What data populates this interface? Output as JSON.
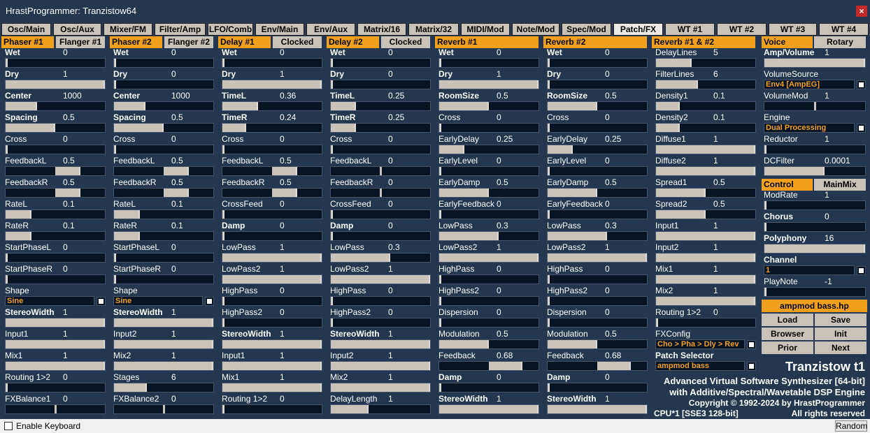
{
  "window": {
    "title": "HrastProgrammer: Tranzistow64",
    "close_glyph": "×"
  },
  "tabs": [
    "Osc/Main",
    "Osc/Aux",
    "Mixer/FM",
    "Filter/Amp",
    "LFO/Comb",
    "Env/Main",
    "Env/Aux",
    "Matrix/16",
    "Matrix/32",
    "MIDI/Mod",
    "Note/Mod",
    "Spec/Mod",
    "Patch/FX",
    "WT #1",
    "WT #2",
    "WT #3",
    "WT #4"
  ],
  "active_tab": "Patch/FX",
  "sections": [
    {
      "header": "Phaser #1",
      "header2": "Flanger #1",
      "params": [
        {
          "label": "Wet",
          "value": "0",
          "bold": true,
          "level": 0
        },
        {
          "label": "Dry",
          "value": "1",
          "bold": true,
          "level": 1
        },
        {
          "label": "Center",
          "value": "1000",
          "bold": true,
          "level": 0.32
        },
        {
          "label": "Spacing",
          "value": "0.5",
          "bold": true,
          "level": 0.5
        },
        {
          "label": "Cross",
          "value": "0",
          "bold": false,
          "level": 0
        },
        {
          "label": "FeedbackL",
          "value": "0.5",
          "bold": false,
          "level": 0.75,
          "bipolar": true
        },
        {
          "label": "FeedbackR",
          "value": "0.5",
          "bold": false,
          "level": 0.75,
          "bipolar": true
        },
        {
          "label": "RateL",
          "value": "0.1",
          "bold": false,
          "level": 0.26
        },
        {
          "label": "RateR",
          "value": "0.1",
          "bold": false,
          "level": 0.26
        },
        {
          "label": "StartPhaseL",
          "value": "0",
          "bold": false,
          "level": 0
        },
        {
          "label": "StartPhaseR",
          "value": "0",
          "bold": false,
          "level": 0
        },
        {
          "label": "Shape",
          "value": "",
          "bold": false,
          "select": "Sine"
        },
        {
          "label": "StereoWidth",
          "value": "1",
          "bold": true,
          "level": 1
        },
        {
          "label": "Input1",
          "value": "1",
          "bold": false,
          "level": 1
        },
        {
          "label": "Mix1",
          "value": "1",
          "bold": false,
          "level": 1
        },
        {
          "label": "Routing 1>2",
          "value": "0",
          "bold": false,
          "level": 0
        },
        {
          "label": "FXBalance1",
          "value": "0",
          "bold": false,
          "level": 0.5,
          "knob": true
        }
      ]
    },
    {
      "header": "Phaser #2",
      "header2": "Flanger #2",
      "params": [
        {
          "label": "Wet",
          "value": "0",
          "bold": true,
          "level": 0
        },
        {
          "label": "Dry",
          "value": "0",
          "bold": true,
          "level": 0
        },
        {
          "label": "Center",
          "value": "1000",
          "bold": true,
          "level": 0.32
        },
        {
          "label": "Spacing",
          "value": "0.5",
          "bold": true,
          "level": 0.5
        },
        {
          "label": "Cross",
          "value": "0",
          "bold": false,
          "level": 0
        },
        {
          "label": "FeedbackL",
          "value": "0.5",
          "bold": false,
          "level": 0.75,
          "bipolar": true
        },
        {
          "label": "FeedbackR",
          "value": "0.5",
          "bold": false,
          "level": 0.75,
          "bipolar": true
        },
        {
          "label": "RateL",
          "value": "0.1",
          "bold": false,
          "level": 0.26
        },
        {
          "label": "RateR",
          "value": "0.1",
          "bold": false,
          "level": 0.26
        },
        {
          "label": "StartPhaseL",
          "value": "0",
          "bold": false,
          "level": 0
        },
        {
          "label": "StartPhaseR",
          "value": "0",
          "bold": false,
          "level": 0
        },
        {
          "label": "Shape",
          "value": "",
          "bold": false,
          "select": "Sine"
        },
        {
          "label": "StereoWidth",
          "value": "1",
          "bold": true,
          "level": 1
        },
        {
          "label": "Input2",
          "value": "1",
          "bold": false,
          "level": 1
        },
        {
          "label": "Mix2",
          "value": "1",
          "bold": false,
          "level": 1
        },
        {
          "label": "Stages",
          "value": "6",
          "bold": false,
          "level": 0.33
        },
        {
          "label": "FXBalance2",
          "value": "0",
          "bold": false,
          "level": 0.5,
          "knob": true
        }
      ]
    },
    {
      "header": "Delay #1",
      "header2": "Clocked",
      "params": [
        {
          "label": "Wet",
          "value": "0",
          "bold": true,
          "level": 0
        },
        {
          "label": "Dry",
          "value": "1",
          "bold": true,
          "level": 1
        },
        {
          "label": "TimeL",
          "value": "0.36",
          "bold": true,
          "level": 0.36
        },
        {
          "label": "TimeR",
          "value": "0.24",
          "bold": true,
          "level": 0.24
        },
        {
          "label": "Cross",
          "value": "0",
          "bold": false,
          "level": 0
        },
        {
          "label": "FeedbackL",
          "value": "0.5",
          "bold": false,
          "level": 0.75,
          "bipolar": true
        },
        {
          "label": "FeedbackR",
          "value": "0.5",
          "bold": false,
          "level": 0.75,
          "bipolar": true
        },
        {
          "label": "CrossFeed",
          "value": "0",
          "bold": false,
          "level": 0
        },
        {
          "label": "Damp",
          "value": "0",
          "bold": true,
          "level": 0
        },
        {
          "label": "LowPass",
          "value": "1",
          "bold": false,
          "level": 1
        },
        {
          "label": "LowPass2",
          "value": "1",
          "bold": false,
          "level": 1
        },
        {
          "label": "HighPass",
          "value": "0",
          "bold": false,
          "level": 0
        },
        {
          "label": "HighPass2",
          "value": "0",
          "bold": false,
          "level": 0
        },
        {
          "label": "StereoWidth",
          "value": "1",
          "bold": true,
          "level": 1
        },
        {
          "label": "Input1",
          "value": "1",
          "bold": false,
          "level": 1
        },
        {
          "label": "Mix1",
          "value": "1",
          "bold": false,
          "level": 1
        },
        {
          "label": "Routing 1>2",
          "value": "0",
          "bold": false,
          "level": 0
        }
      ]
    },
    {
      "header": "Delay #2",
      "header2": "Clocked",
      "params": [
        {
          "label": "Wet",
          "value": "0",
          "bold": true,
          "level": 0
        },
        {
          "label": "Dry",
          "value": "0",
          "bold": true,
          "level": 0
        },
        {
          "label": "TimeL",
          "value": "0.25",
          "bold": true,
          "level": 0.25
        },
        {
          "label": "TimeR",
          "value": "0.25",
          "bold": true,
          "level": 0.25
        },
        {
          "label": "Cross",
          "value": "0",
          "bold": false,
          "level": 0
        },
        {
          "label": "FeedbackL",
          "value": "0",
          "bold": false,
          "level": 0.5,
          "knob": true
        },
        {
          "label": "FeedbackR",
          "value": "0",
          "bold": false,
          "level": 0.5,
          "knob": true
        },
        {
          "label": "CrossFeed",
          "value": "0",
          "bold": false,
          "level": 0
        },
        {
          "label": "Damp",
          "value": "0",
          "bold": true,
          "level": 0
        },
        {
          "label": "LowPass",
          "value": "0.3",
          "bold": false,
          "level": 0.6
        },
        {
          "label": "LowPass2",
          "value": "1",
          "bold": false,
          "level": 1
        },
        {
          "label": "HighPass",
          "value": "0",
          "bold": false,
          "level": 0
        },
        {
          "label": "HighPass2",
          "value": "0",
          "bold": false,
          "level": 0
        },
        {
          "label": "StereoWidth",
          "value": "1",
          "bold": true,
          "level": 1
        },
        {
          "label": "Input2",
          "value": "1",
          "bold": false,
          "level": 1
        },
        {
          "label": "Mix2",
          "value": "1",
          "bold": false,
          "level": 1
        },
        {
          "label": "DelayLength",
          "value": "1",
          "bold": false,
          "level": 0.38
        }
      ]
    },
    {
      "header": "Reverb #1",
      "header2": "",
      "params": [
        {
          "label": "Wet",
          "value": "0",
          "bold": true,
          "level": 0
        },
        {
          "label": "Dry",
          "value": "1",
          "bold": true,
          "level": 1
        },
        {
          "label": "RoomSize",
          "value": "0.5",
          "bold": true,
          "level": 0.5
        },
        {
          "label": "Cross",
          "value": "0",
          "bold": false,
          "level": 0
        },
        {
          "label": "EarlyDelay",
          "value": "0.25",
          "bold": false,
          "level": 0.25
        },
        {
          "label": "EarlyLevel",
          "value": "0",
          "bold": false,
          "level": 0
        },
        {
          "label": "EarlyDamp",
          "value": "0.5",
          "bold": false,
          "level": 0.5
        },
        {
          "label": "EarlyFeedback",
          "value": "0",
          "bold": false,
          "level": 0
        },
        {
          "label": "LowPass",
          "value": "0.3",
          "bold": false,
          "level": 0.6
        },
        {
          "label": "LowPass2",
          "value": "1",
          "bold": false,
          "level": 1
        },
        {
          "label": "HighPass",
          "value": "0",
          "bold": false,
          "level": 0
        },
        {
          "label": "HighPass2",
          "value": "0",
          "bold": false,
          "level": 0
        },
        {
          "label": "Dispersion",
          "value": "0",
          "bold": false,
          "level": 0
        },
        {
          "label": "Modulation",
          "value": "0.5",
          "bold": false,
          "level": 0.5
        },
        {
          "label": "Feedback",
          "value": "0.68",
          "bold": false,
          "level": 0.84,
          "bipolar": true
        },
        {
          "label": "Damp",
          "value": "0",
          "bold": true,
          "level": 0
        },
        {
          "label": "StereoWidth",
          "value": "1",
          "bold": true,
          "level": 1
        }
      ]
    },
    {
      "header": "Reverb #2",
      "header2": "",
      "params": [
        {
          "label": "Wet",
          "value": "0",
          "bold": true,
          "level": 0
        },
        {
          "label": "Dry",
          "value": "0",
          "bold": true,
          "level": 0
        },
        {
          "label": "RoomSize",
          "value": "0.5",
          "bold": true,
          "level": 0.5
        },
        {
          "label": "Cross",
          "value": "0",
          "bold": false,
          "level": 0
        },
        {
          "label": "EarlyDelay",
          "value": "0.25",
          "bold": false,
          "level": 0.25
        },
        {
          "label": "EarlyLevel",
          "value": "0",
          "bold": false,
          "level": 0
        },
        {
          "label": "EarlyDamp",
          "value": "0.5",
          "bold": false,
          "level": 0.5
        },
        {
          "label": "EarlyFeedback",
          "value": "0",
          "bold": false,
          "level": 0
        },
        {
          "label": "LowPass",
          "value": "0.3",
          "bold": false,
          "level": 0.6
        },
        {
          "label": "LowPass2",
          "value": "1",
          "bold": false,
          "level": 1
        },
        {
          "label": "HighPass",
          "value": "0",
          "bold": false,
          "level": 0
        },
        {
          "label": "HighPass2",
          "value": "0",
          "bold": false,
          "level": 0
        },
        {
          "label": "Dispersion",
          "value": "0",
          "bold": false,
          "level": 0
        },
        {
          "label": "Modulation",
          "value": "0.5",
          "bold": false,
          "level": 0.5
        },
        {
          "label": "Feedback",
          "value": "0.68",
          "bold": false,
          "level": 0.84,
          "bipolar": true
        },
        {
          "label": "Damp",
          "value": "0",
          "bold": true,
          "level": 0
        },
        {
          "label": "StereoWidth",
          "value": "1",
          "bold": true,
          "level": 1
        }
      ]
    },
    {
      "header": "Reverb #1 & #2",
      "header2": "",
      "params": [
        {
          "label": "DelayLines",
          "value": "5",
          "bold": false,
          "level": 0.36
        },
        {
          "label": "FilterLines",
          "value": "6",
          "bold": false,
          "level": 0.42
        },
        {
          "label": "Density1",
          "value": "0.1",
          "bold": false,
          "level": 0.24
        },
        {
          "label": "Density2",
          "value": "0.1",
          "bold": false,
          "level": 0.24
        },
        {
          "label": "Diffuse1",
          "value": "1",
          "bold": false,
          "level": 1
        },
        {
          "label": "Diffuse2",
          "value": "1",
          "bold": false,
          "level": 1
        },
        {
          "label": "Spread1",
          "value": "0.5",
          "bold": false,
          "level": 0.5
        },
        {
          "label": "Spread2",
          "value": "0.5",
          "bold": false,
          "level": 0.5
        },
        {
          "label": "Input1",
          "value": "1",
          "bold": false,
          "level": 1
        },
        {
          "label": "Input2",
          "value": "1",
          "bold": false,
          "level": 1
        },
        {
          "label": "Mix1",
          "value": "1",
          "bold": false,
          "level": 1
        },
        {
          "label": "Mix2",
          "value": "1",
          "bold": false,
          "level": 1
        },
        {
          "label": "Routing 1>2",
          "value": "0",
          "bold": false,
          "level": 0
        },
        {
          "label": "FXConfig",
          "value": "",
          "bold": false,
          "select": "Cho > Pha > Dly > Rev"
        },
        {
          "label": "Patch Selector",
          "value": "",
          "bold": true,
          "select": "ampmod bass"
        }
      ]
    }
  ],
  "voice": {
    "header": "Voice",
    "header2": "Rotary",
    "params": [
      {
        "label": "Amp/Volume",
        "value": "1",
        "bold": true,
        "level": 1
      },
      {
        "label": "VolumeSource",
        "value": "",
        "bold": false,
        "select": "Env4 [AmpEG]"
      },
      {
        "label": "VolumeMod",
        "value": "1",
        "bold": false,
        "level": 0.5,
        "knob": true,
        "bipolarFill": true
      },
      {
        "label": "Engine",
        "value": "",
        "bold": false,
        "select": "Dual Processing"
      },
      {
        "label": "Reductor",
        "value": "1",
        "bold": false,
        "level": 0
      },
      {
        "label": "DCFilter",
        "value": "0.0001",
        "bold": false,
        "level": 0.6
      }
    ],
    "control_tab": "Control",
    "mainmix_tab": "MainMix",
    "params2": [
      {
        "label": "ModRate",
        "value": "1",
        "bold": false,
        "level": 0
      },
      {
        "label": "Chorus",
        "value": "0",
        "bold": true,
        "level": 0
      },
      {
        "label": "Polyphony",
        "value": "16",
        "bold": true,
        "level": 1
      },
      {
        "label": "Channel",
        "value": "",
        "bold": true,
        "select": "1"
      },
      {
        "label": "PlayNote",
        "value": "-1",
        "bold": false,
        "level": 0
      }
    ],
    "preset": "ampmod bass.hp",
    "buttons": [
      "Load",
      "Save",
      "Browser",
      "Init",
      "Prior",
      "Next"
    ]
  },
  "info": {
    "product": "Tranzistow t1",
    "line1": "Advanced Virtual Software Synthesizer [64-bit]",
    "line2": "with Additive/Spectral/Wavetable DSP Engine",
    "line3": "Copyright © 1992-2024 by HrastProgrammer",
    "cpu": "CPU*1 [SSE3 128-bit]",
    "rights": "All rights reserved"
  },
  "statusbar": {
    "enable_keyboard": "Enable Keyboard",
    "random": "Random"
  }
}
